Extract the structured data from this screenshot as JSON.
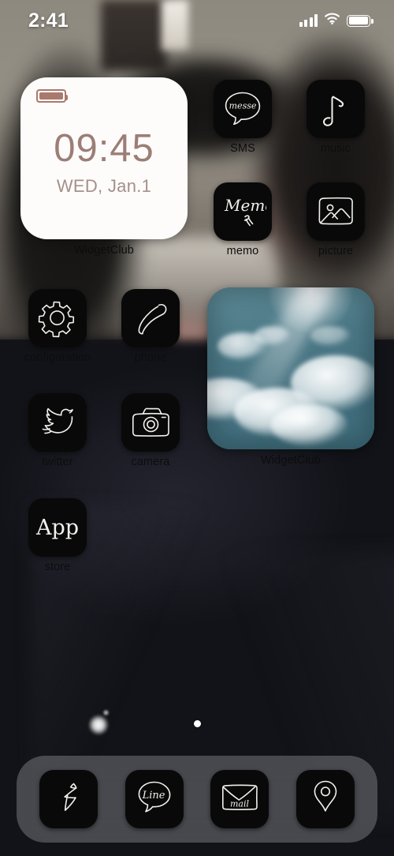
{
  "status_bar": {
    "time": "2:41",
    "signal_icon": "cellular-bars-icon",
    "wifi_icon": "wifi-icon",
    "battery_icon": "battery-icon"
  },
  "clock_widget": {
    "time": "09:45",
    "date": "WED, Jan.1",
    "label": "WidgetClub",
    "battery_icon": "battery-icon",
    "accent_color": "#9c7e76",
    "card_color": "#fdfcfb"
  },
  "photo_widget": {
    "label": "WidgetClub",
    "image_description": "sky-with-sun-and-clouds"
  },
  "apps": [
    {
      "label": "SMS",
      "icon": "message-bubble-icon",
      "icon_text": "messe"
    },
    {
      "label": "music",
      "icon": "music-note-icon",
      "icon_text": ""
    },
    {
      "label": "memo",
      "icon": "memo-pen-icon",
      "icon_text": "Memo"
    },
    {
      "label": "picture",
      "icon": "photo-frame-icon",
      "icon_text": ""
    },
    {
      "label": "configuration",
      "icon": "gear-icon",
      "icon_text": ""
    },
    {
      "label": "phone",
      "icon": "telephone-handset-icon",
      "icon_text": ""
    },
    {
      "label": "twitter",
      "icon": "twitter-bird-icon",
      "icon_text": ""
    },
    {
      "label": "camera",
      "icon": "camera-icon",
      "icon_text": ""
    },
    {
      "label": "store",
      "icon": "app-store-icon",
      "icon_text": "App"
    }
  ],
  "dock": [
    {
      "label": "safari",
      "icon": "compass-needle-icon",
      "icon_text": ""
    },
    {
      "label": "line",
      "icon": "line-bubble-icon",
      "icon_text": "Line"
    },
    {
      "label": "mail",
      "icon": "envelope-icon",
      "icon_text": "mail"
    },
    {
      "label": "maps",
      "icon": "map-pin-icon",
      "icon_text": ""
    }
  ],
  "page_indicator": {
    "total_pages": 1,
    "current_page": 1
  }
}
